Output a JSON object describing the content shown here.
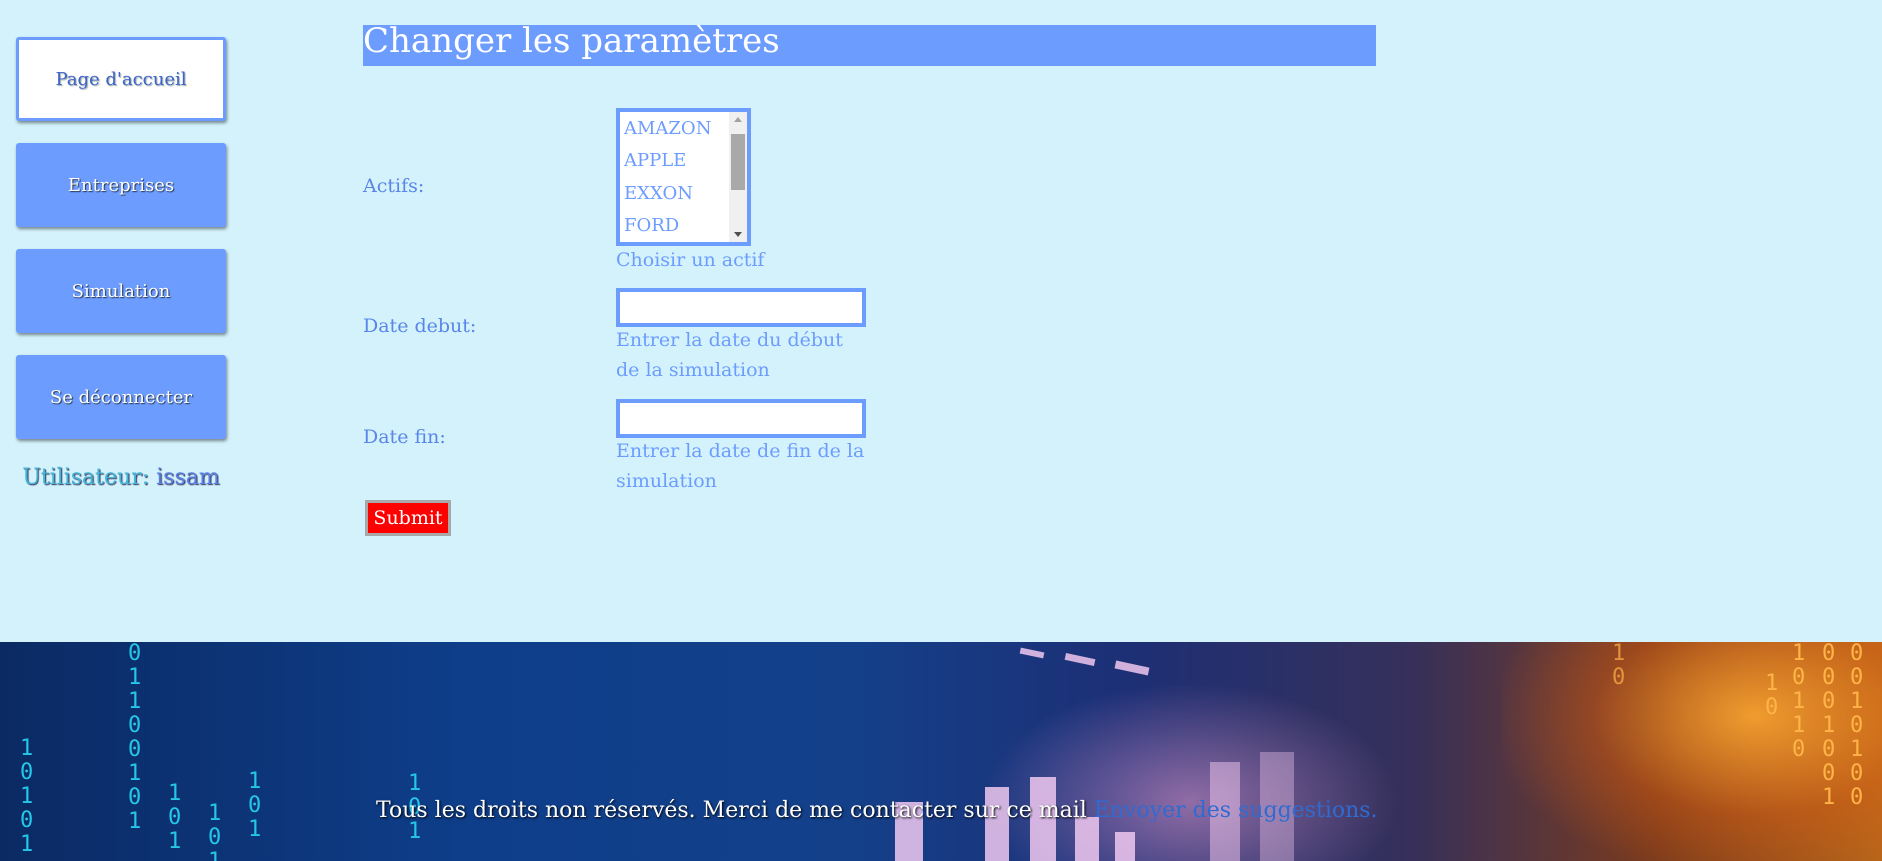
{
  "sidebar": {
    "items": [
      {
        "label": "Page d'accueil",
        "active": true
      },
      {
        "label": "Entreprises",
        "active": false
      },
      {
        "label": "Simulation",
        "active": false
      },
      {
        "label": "Se déconnecter",
        "active": false
      }
    ],
    "user_prefix": "Utilisateur:",
    "user_name": "issam"
  },
  "form": {
    "title": "Changer les paramètres",
    "assets_label": "Actifs:",
    "assets_options": [
      "AMAZON",
      "APPLE",
      "EXXON",
      "FORD"
    ],
    "assets_hint": "Choisir un actif",
    "start_label": "Date debut:",
    "start_value": "",
    "start_hint": "Entrer la date du début de la simulation",
    "end_label": "Date fin:",
    "end_value": "",
    "end_hint": "Entrer la date de fin de la simulation",
    "submit_label": "Submit"
  },
  "footer": {
    "text": "Tous les droits non réservés. Merci de me contacter sur ce mail",
    "link_label": "Envoyer des suggestions."
  },
  "colors": {
    "background": "#d3f2fc",
    "accent": "#6d9cff",
    "submit": "#ff0000"
  }
}
